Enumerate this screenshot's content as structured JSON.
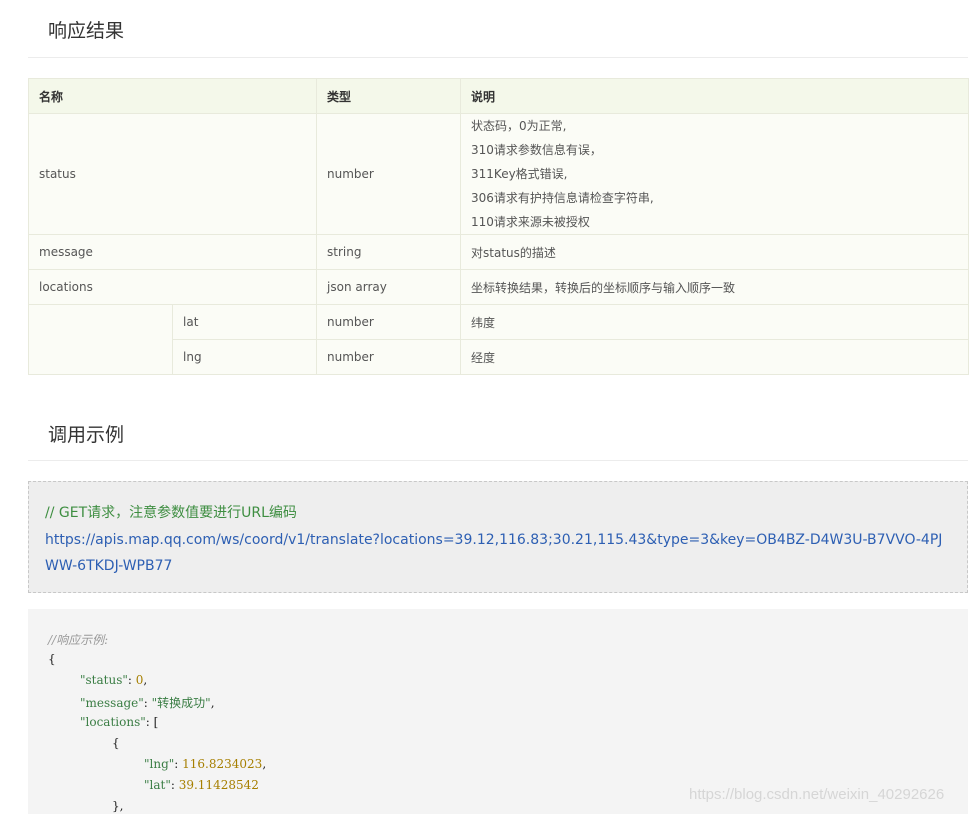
{
  "response_section": {
    "title": "响应结果",
    "table": {
      "headers": [
        "名称",
        "类型",
        "说明"
      ],
      "rows": {
        "status": {
          "name": "status",
          "type": "number",
          "desc_lines": [
            "状态码，0为正常,",
            "310请求参数信息有误，",
            "311Key格式错误,",
            "306请求有护持信息请检查字符串,",
            "110请求来源未被授权"
          ]
        },
        "message": {
          "name": "message",
          "type": "string",
          "desc": "对status的描述"
        },
        "locations": {
          "name": "locations",
          "type": "json array",
          "desc": "坐标转换结果，转换后的坐标顺序与输入顺序一致"
        },
        "lat": {
          "name": "lat",
          "type": "number",
          "desc": "纬度"
        },
        "lng": {
          "name": "lng",
          "type": "number",
          "desc": "经度"
        }
      }
    }
  },
  "example_section": {
    "title": "调用示例",
    "request_comment": "// GET请求，注意参数值要进行URL编码",
    "request_url": "https://apis.map.qq.com/ws/coord/v1/translate?locations=39.12,116.83;30.21,115.43&type=3&key=OB4BZ-D4W3U-B7VVO-4PJWW-6TKDJ-WPB77",
    "response_code": {
      "comment": "//响应示例:",
      "open_brace": "{",
      "status_key": "\"status\"",
      "status_value": "0",
      "message_key": "\"message\"",
      "message_value": "\"转换成功\"",
      "locations_key": "\"locations\"",
      "open_bracket": "[",
      "item_open": "{",
      "lng_key": "\"lng\"",
      "lng_value": "116.8234023",
      "lat_key": "\"lat\"",
      "lat_value": "39.11428542",
      "item_close": "},"
    }
  },
  "watermark": "https://blog.csdn.net/weixin_40292626"
}
